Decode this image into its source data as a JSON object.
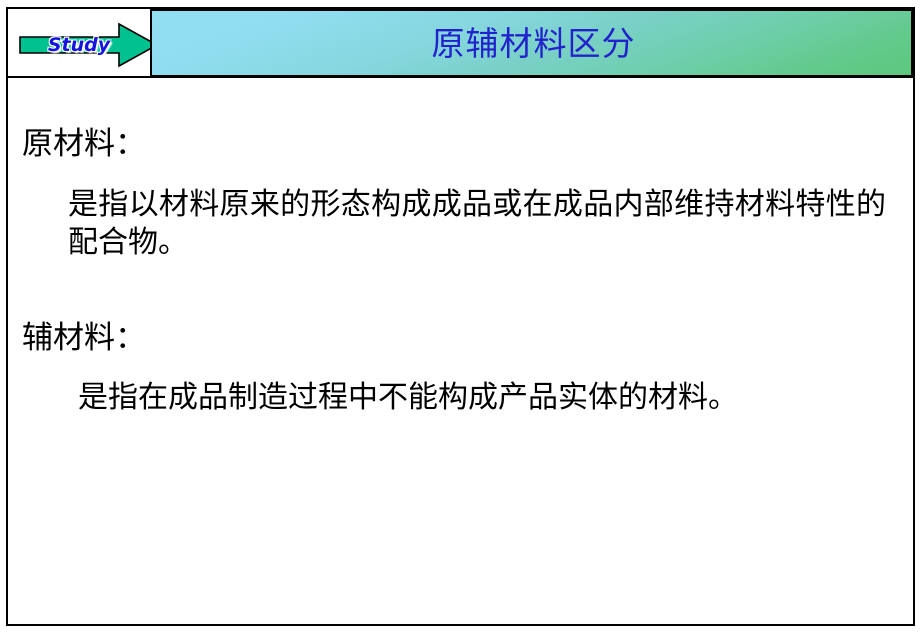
{
  "slide": {
    "badge": {
      "label": "Study",
      "icon": "right-arrow-icon",
      "arrow_color": "#00c291",
      "label_color": "#1414dd"
    },
    "header": {
      "title": "原辅材料区分",
      "title_color": "#2222cc",
      "gradient_from": "#93dff2",
      "gradient_to": "#5cc87c"
    },
    "sections": [
      {
        "heading": "原材料：",
        "body": "是指以材料原来的形态构成成品或在成品内部维持材料特性的配合物。"
      },
      {
        "heading": "辅材料：",
        "body": "是指在成品制造过程中不能构成产品实体的材料。"
      }
    ]
  }
}
